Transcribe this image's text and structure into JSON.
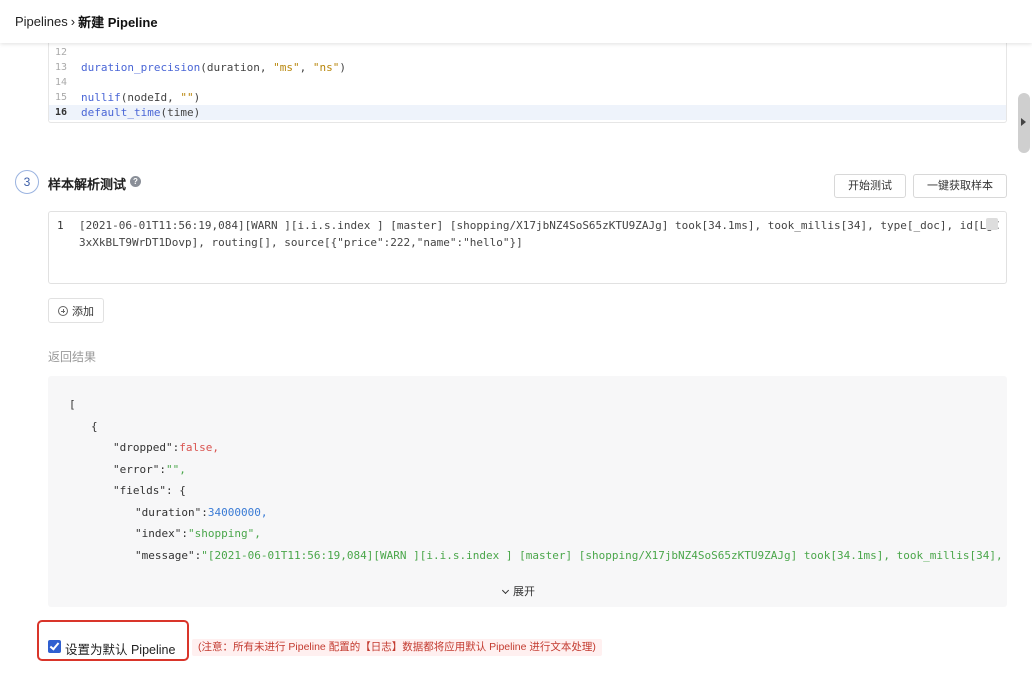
{
  "header": {
    "crumb_root": "Pipelines",
    "crumb_sep": "›",
    "crumb_current": "新建 Pipeline"
  },
  "editor": {
    "lines": [
      {
        "num": "12",
        "text": ""
      },
      {
        "num": "13",
        "fn": "duration_precision",
        "args_before": "(duration, ",
        "s1": "\"ms\"",
        "mid": ", ",
        "s2": "\"ns\"",
        "after": ")"
      },
      {
        "num": "14",
        "text": ""
      },
      {
        "num": "15",
        "fn": "nullif",
        "args_before": "(nodeId, ",
        "s1": "\"\"",
        "after": ")"
      },
      {
        "num": "16",
        "fn": "default_time",
        "after": "(time)"
      }
    ]
  },
  "section3": {
    "step": "3",
    "title": "样本解析测试",
    "help_icon": "question-circle-icon",
    "btn_test": "开始测试",
    "btn_fetch": "一键获取样本"
  },
  "sample": {
    "line_num": "1",
    "text": "[2021-06-01T11:56:19,084][WARN ][i.i.s.index              ] [master] [shopping/X17jbNZ4SoS65zKTU9ZAJg] took[34.1ms], took_millis[34], type[_doc], id[LgC3xXkBLT9WrDT1Dovp], routing[], source[{\"price\":222,\"name\":\"hello\"}]"
  },
  "add_button": "添加",
  "result_label": "返回结果",
  "result": {
    "bracket_open": "[",
    "brace_open": "{",
    "dropped_key": "\"dropped\"",
    "dropped_val": "false,",
    "error_key": "\"error\"",
    "error_val": "\"\",",
    "fields_key": "\"fields\"",
    "fields_open": ": {",
    "duration_key": "\"duration\"",
    "duration_val": "34000000,",
    "index_key": "\"index\"",
    "index_val": "\"shopping\",",
    "message_key": "\"message\"",
    "message_val": "\"[2021-06-01T11:56:19,084][WARN ][i.i.s.index ] [master] [shopping/X17jbNZ4SoS65zKTU9ZAJg] took[34.1ms], took_millis[34],",
    "expand": "展开"
  },
  "default_pipeline": {
    "checked": true,
    "label": "设置为默认 Pipeline",
    "note": "(注意：所有未进行 Pipeline 配置的【日志】数据都将应用默认 Pipeline 进行文本处理)"
  },
  "colors": {
    "accent": "#2f5fd0",
    "highlight_border": "#d9352a",
    "note_text": "#c33a2f"
  }
}
